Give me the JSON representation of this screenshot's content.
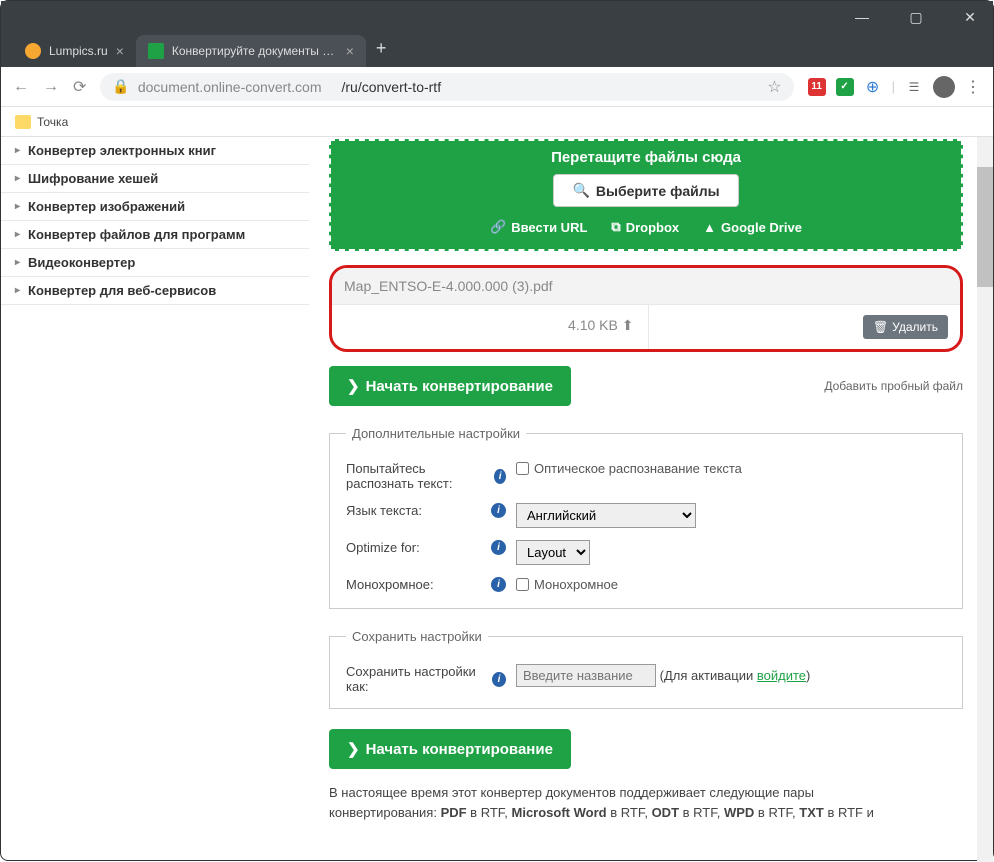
{
  "window": {
    "minimize": "—",
    "maximize": "▢",
    "close": "✕"
  },
  "tabs": [
    {
      "title": "Lumpics.ru",
      "iconColor": "#f7a832",
      "active": false
    },
    {
      "title": "Конвертируйте документы в фо",
      "iconColor": "#1fa246",
      "active": true
    }
  ],
  "addressbar": {
    "url_host": "document.online-convert.com",
    "url_path": "/ru/convert-to-rtf"
  },
  "bookmarks": {
    "item": "Точка"
  },
  "sidebar": [
    "Конвертер электронных книг",
    "Шифрование хешей",
    "Конвертер изображений",
    "Конвертер файлов для программ",
    "Видеоконвертер",
    "Конвертер для веб-сервисов"
  ],
  "dropzone": {
    "title": "Перетащите файлы сюда",
    "choose": "Выберите файлы",
    "url": "Ввести URL",
    "dropbox": "Dropbox",
    "gdrive": "Google Drive"
  },
  "file": {
    "name": "Map_ENTSO-E-4.000.000 (3).pdf",
    "size": "4.10 KB",
    "delete": "Удалить"
  },
  "start_button": "Начать конвертирование",
  "add_sample": "Добавить пробный файл",
  "fieldset1": {
    "legend": "Дополнительные настройки",
    "ocr_label": "Попытайтесь распознать текст:",
    "ocr_cb": "Оптическое распознавание текста",
    "lang_label": "Язык текста:",
    "lang_value": "Английский",
    "optimize_label": "Optimize for:",
    "optimize_value": "Layout",
    "mono_label": "Монохромное:",
    "mono_cb": "Монохромное"
  },
  "fieldset2": {
    "legend": "Сохранить настройки",
    "save_label": "Сохранить настройки как:",
    "save_placeholder": "Введите название",
    "activation_prefix": "(Для активации ",
    "login": "войдите",
    "activation_suffix": ")"
  },
  "footer": {
    "line1": "В настоящее время этот конвертер документов поддерживает следующие пары",
    "line2_prefix": "конвертирования: ",
    "p1": "PDF",
    "t1": " в RTF, ",
    "p2": "Microsoft Word",
    "t2": " в RTF, ",
    "p3": "ODT",
    "t3": " в RTF, ",
    "p4": "WPD",
    "t4": " в RTF, ",
    "p5": "TXT",
    "t5": " в RTF и"
  }
}
